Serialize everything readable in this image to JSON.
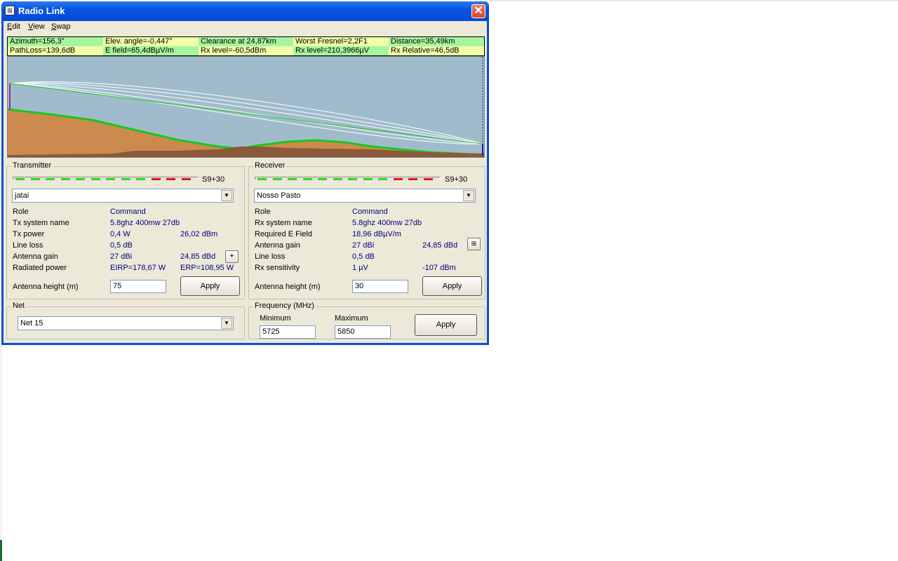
{
  "window": {
    "title": "Radio Link",
    "icon": "radio-link-app-icon",
    "close": "✕"
  },
  "menu": [
    {
      "label": "Edit",
      "underline": "E",
      "rest": "dit"
    },
    {
      "label": "View",
      "underline": "V",
      "rest": "iew"
    },
    {
      "label": "Swap",
      "underline": "S",
      "rest": "wap"
    }
  ],
  "info": {
    "row1": [
      "Azimuth=156,3°",
      "Elev. angle=-0,447°",
      "Clearance at 24,87km",
      "Worst Fresnel=2,2F1",
      "Distance=35,49km"
    ],
    "row2": [
      "PathLoss=139,6dB",
      "E field=65,4dBµV/m",
      "Rx level=-60,5dBm",
      "Rx level=210,3966µV",
      "Rx Relative=46,5dB"
    ],
    "colors": {
      "green": "#a6f59e",
      "yellow": "#f0ffa8"
    }
  },
  "profile": {
    "colors": {
      "sky": "#a0bccc",
      "terrain": "#cd8a4e",
      "ground": "#8a5a3a",
      "los": "#18c818",
      "fresnel": "#ffffff",
      "tx_mast": "#9a2a9a",
      "rx_mast": "#2020b0"
    }
  },
  "transmitter": {
    "title": "Transmitter",
    "meter_label": "S9+30",
    "meter_green": 9,
    "meter_red": 3,
    "site": "jatai",
    "rows": [
      {
        "label": "Role",
        "value": "Command",
        "value2": ""
      },
      {
        "label": "Tx system name",
        "value": "5.8ghz 400mw 27db",
        "value2": ""
      },
      {
        "label": "Tx power",
        "value": "0,4 W",
        "value2": "26,02 dBm"
      },
      {
        "label": "Line loss",
        "value": "0,5 dB",
        "value2": ""
      },
      {
        "label": "Antenna gain",
        "value": "27 dBi",
        "value2": "24,85 dBd"
      },
      {
        "label": "Radiated power",
        "value": "EIRP=178,67 W",
        "value2": "ERP=108,95 W"
      }
    ],
    "plus_button": "+",
    "height_label": "Antenna height (m)",
    "height_value": "75",
    "apply": "Apply"
  },
  "receiver": {
    "title": "Receiver",
    "meter_label": "S9+30",
    "meter_green": 9,
    "meter_red": 3,
    "site": "Nosso Pasto",
    "rows": [
      {
        "label": "Role",
        "value": "Command",
        "value2": ""
      },
      {
        "label": "Rx system name",
        "value": "5.8ghz 400mw 27db",
        "value2": ""
      },
      {
        "label": "Required E Field",
        "value": "18,96 dBµV/m",
        "value2": ""
      },
      {
        "label": "Antenna gain",
        "value": "27 dBi",
        "value2": "24,85 dBd"
      },
      {
        "label": "Line loss",
        "value": "0,5 dB",
        "value2": ""
      },
      {
        "label": "Rx sensitivity",
        "value": "1 µV",
        "value2": "-107 dBm"
      }
    ],
    "height_label": "Antenna height (m)",
    "height_value": "30",
    "apply": "Apply"
  },
  "net": {
    "title": "Net",
    "value": "Net 15"
  },
  "frequency": {
    "title": "Frequency (MHz)",
    "min_label": "Minimum",
    "min_value": "5725",
    "max_label": "Maximum",
    "max_value": "5850",
    "apply": "Apply"
  }
}
